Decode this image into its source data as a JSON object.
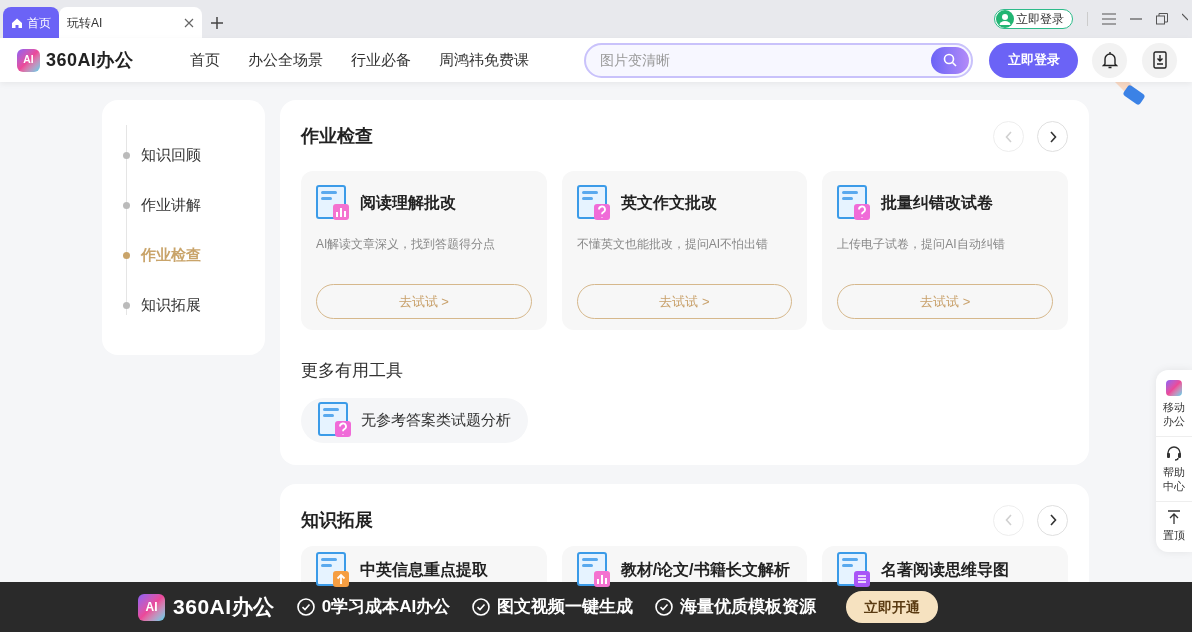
{
  "browser_tabs": [
    {
      "label": "首页",
      "selected": false,
      "kind": "home"
    },
    {
      "label": "玩转AI",
      "selected": true,
      "kind": "page"
    }
  ],
  "browser_login": "立即登录",
  "site": {
    "logo_badge": "AI",
    "logo_text": "360AI办公",
    "nav": [
      "首页",
      "办公全场景",
      "行业必备",
      "周鸿祎免费课"
    ],
    "search": {
      "placeholder": "图片变清晰"
    },
    "login_button": "立即登录"
  },
  "sidebar": {
    "items": [
      {
        "label": "知识回顾",
        "selected": false
      },
      {
        "label": "作业讲解",
        "selected": false
      },
      {
        "label": "作业检查",
        "selected": true
      },
      {
        "label": "知识拓展",
        "selected": false
      }
    ]
  },
  "sections": [
    {
      "title": "作业检查",
      "prev_disabled": true,
      "cards": [
        {
          "title": "阅读理解批改",
          "description": "AI解读文章深义，找到答题得分点",
          "button": "去试试 >",
          "kind": "chart"
        },
        {
          "title": "英文作文批改",
          "description": "不懂英文也能批改，提问AI不怕出错",
          "button": "去试试 >",
          "kind": "question"
        },
        {
          "title": "批量纠错改试卷",
          "description": "上传电子试卷，提问AI自动纠错",
          "button": "去试试 >",
          "kind": "question"
        }
      ],
      "more_title": "更多有用工具",
      "more_tools": [
        {
          "label": "无参考答案类试题分析",
          "kind": "question"
        }
      ]
    },
    {
      "title": "知识拓展",
      "prev_disabled": true,
      "cards": [
        {
          "title": "中英信息重点提取",
          "kind": "arrow"
        },
        {
          "title": "教材/论文/书籍长文解析",
          "kind": "chart"
        },
        {
          "title": "名著阅读思维导图",
          "kind": "list"
        }
      ]
    }
  ],
  "side_toolbar": [
    {
      "label": "移动办公",
      "kind": "ai"
    },
    {
      "label": "帮助中心",
      "kind": "headset"
    },
    {
      "label": "置顶",
      "kind": "top"
    }
  ],
  "banner": {
    "logo_badge": "AI",
    "logo_text": "360AI办公",
    "features": [
      "0学习成本AI办公",
      "图文视频一键生成",
      "海量优质模板资源"
    ],
    "button": "立即开通"
  }
}
